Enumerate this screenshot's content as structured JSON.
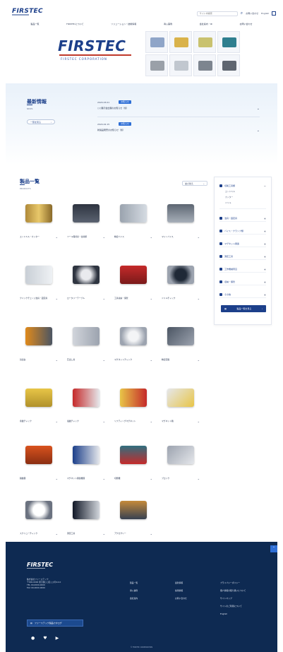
{
  "header": {
    "logo": "FIRSTEC",
    "search_placeholder": "サイト内検索",
    "links": [
      "お問い合わせ",
      "English"
    ],
    "nav": [
      "製品一覧",
      "FIRSTECについて",
      "ソリューション・技術情報",
      "導入事例",
      "会社案内・IR",
      "お問い合わせ"
    ]
  },
  "hero": {
    "logo": "FIRSTEC",
    "subtitle": "FIRSTEC CORPORATION"
  },
  "news": {
    "title": "最新情報",
    "subtitle": "NEWS",
    "more_label": "一覧を見る",
    "items": [
      {
        "date": "2024.03.01",
        "tag": "お知らせ",
        "text": "○○展示会出展のお知らせ（仮）"
      },
      {
        "date": "2024.02.15",
        "tag": "お知らせ",
        "text": "新製品発売のお知らせ（仮）"
      }
    ]
  },
  "products": {
    "title": "製品一覧",
    "subtitle": "PRODUCTS",
    "sort_label": "並び替え",
    "items": [
      {
        "name": "エンドミル・カッター",
        "icon": "end-mill"
      },
      {
        "name": "ツール保持具・治具類",
        "icon": "tool-holder"
      },
      {
        "name": "精密バイス",
        "icon": "precision-vise"
      },
      {
        "name": "マシンバイス",
        "icon": "machine-vise"
      },
      {
        "name": "クイックチェンジ治具・固定具",
        "icon": "quick-change"
      },
      {
        "name": "ロータリーテーブル",
        "icon": "rotary-table"
      },
      {
        "name": "工具収納・保管",
        "icon": "tool-case"
      },
      {
        "name": "ドリルチャック",
        "icon": "drill-chuck"
      },
      {
        "name": "割出台",
        "icon": "indexing-head"
      },
      {
        "name": "芯出し具",
        "icon": "centering-tool"
      },
      {
        "name": "マグネットチャック",
        "icon": "magnetic-chuck"
      },
      {
        "name": "精密定盤",
        "icon": "surface-plate"
      },
      {
        "name": "永磁チャック",
        "icon": "permanent-chuck"
      },
      {
        "name": "電磁チャック",
        "icon": "electro-chuck"
      },
      {
        "name": "リフティングマグネット",
        "icon": "lifting-magnet"
      },
      {
        "name": "マグネット箱",
        "icon": "magnet-block"
      },
      {
        "name": "脱磁器",
        "icon": "demagnetizer"
      },
      {
        "name": "マグネット関連機器",
        "icon": "magnet-equipment"
      },
      {
        "name": "切断機",
        "icon": "cutting-machine"
      },
      {
        "name": "ブロック",
        "icon": "block"
      },
      {
        "name": "スクリューチャック",
        "icon": "screw-chuck"
      },
      {
        "name": "測定工具",
        "icon": "measuring-tool"
      },
      {
        "name": "アクセサリー",
        "icon": "accessory"
      }
    ]
  },
  "sidebar": {
    "categories": [
      {
        "label": "切削工具類",
        "expanded": true,
        "children": [
          "エンドミル",
          "カッター",
          "ドリル"
        ]
      },
      {
        "label": "治具・固定具"
      },
      {
        "label": "バイス・クランプ類"
      },
      {
        "label": "マグネット関連"
      },
      {
        "label": "測定工具"
      },
      {
        "label": "工作機械周辺"
      },
      {
        "label": "収納・保管"
      },
      {
        "label": "その他"
      }
    ],
    "button_label": "製品一覧を見る"
  },
  "footer": {
    "logo": "FIRSTEC",
    "address": [
      "株式会社ファーステック",
      "〒000-0000 東京都○○区○○町0-0-0",
      "TEL 00-0000-0000",
      "FAX 00-0000-0000"
    ],
    "button_label": "ファーステック製品カタログ",
    "col1": [
      "製品一覧",
      "導入事例",
      "会社案内"
    ],
    "col2": [
      "最新情報",
      "採用情報",
      "お問い合わせ"
    ],
    "col3": [
      "プライバシーポリシー",
      "個人情報の取り扱いについて",
      "サイトマップ",
      "サイトのご利用について",
      "English"
    ],
    "copyright": "© FIRSTEC CORPORATION"
  },
  "colors": {
    "brand": "#1c3f8a",
    "accent": "#2f6fd6",
    "footer": "#0e2a52",
    "hero_rule": "#c0392b"
  }
}
